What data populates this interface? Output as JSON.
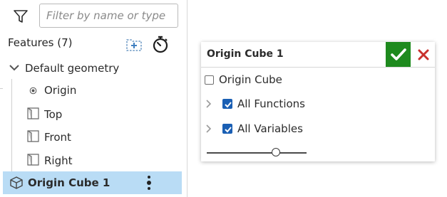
{
  "feature_panel": {
    "filter_placeholder": "Filter by name or type",
    "filter_value": "",
    "features_title": "Features (7)",
    "default_geometry_label": "Default geometry",
    "origin_label": "Origin",
    "planes": [
      {
        "label": "Top"
      },
      {
        "label": "Front"
      },
      {
        "label": "Right"
      }
    ],
    "selected_feature_label": "Origin Cube 1"
  },
  "dialog": {
    "title": "Origin Cube 1",
    "origin_cube_label": "Origin Cube",
    "origin_cube_checked": false,
    "functions_label": "All Functions",
    "functions_checked": true,
    "variables_label": "All Variables",
    "variables_checked": true,
    "slider_value_fraction": 0.69
  },
  "colors": {
    "selection_highlight": "#b9dcf5",
    "accept_green": "#1e8a1e",
    "cancel_red": "#c9302c",
    "checkbox_blue": "#1a5fb4"
  },
  "icons": {
    "filter": "funnel-icon",
    "new_folder": "new-folder-icon",
    "rollback": "stopwatch-icon",
    "expand": "chevron-down-icon",
    "origin": "origin-point-icon",
    "plane": "plane-icon",
    "part": "cube-icon",
    "more": "kebab-icon",
    "accept": "checkmark-icon",
    "cancel": "x-icon"
  }
}
